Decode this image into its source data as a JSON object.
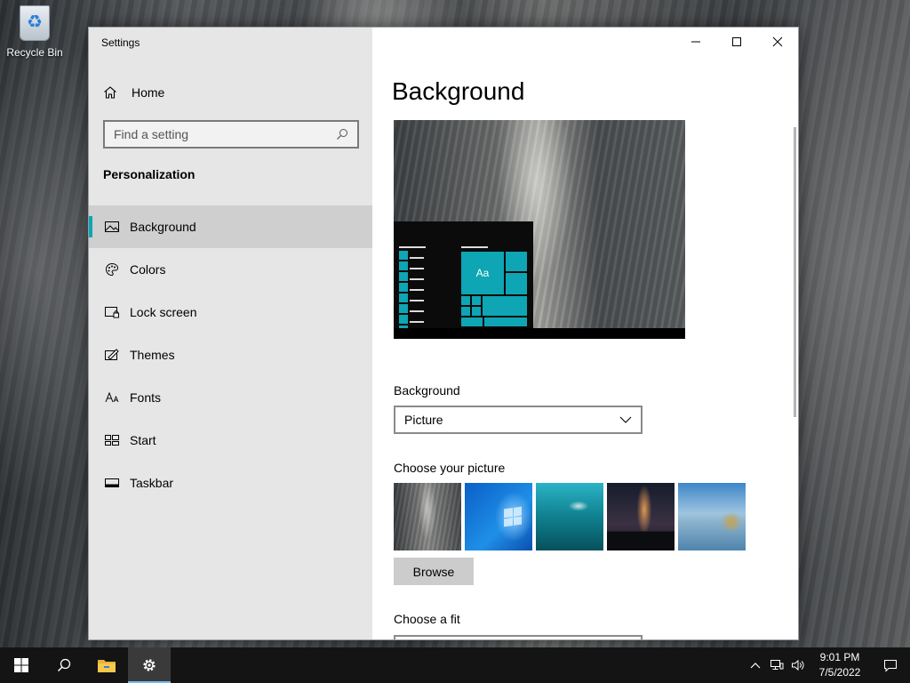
{
  "desktop": {
    "icons": [
      {
        "label": "Recycle Bin",
        "icon": "recycle-bin-icon"
      }
    ]
  },
  "window": {
    "title": "Settings",
    "controls": {
      "minimize": "minimize-icon",
      "maximize": "maximize-icon",
      "close": "close-icon"
    }
  },
  "sidebar": {
    "home_label": "Home",
    "search_placeholder": "Find a setting",
    "section_title": "Personalization",
    "items": [
      {
        "label": "Background",
        "icon": "picture-icon",
        "active": true
      },
      {
        "label": "Colors",
        "icon": "palette-icon",
        "active": false
      },
      {
        "label": "Lock screen",
        "icon": "lock-screen-icon",
        "active": false
      },
      {
        "label": "Themes",
        "icon": "themes-icon",
        "active": false
      },
      {
        "label": "Fonts",
        "icon": "fonts-icon",
        "active": false
      },
      {
        "label": "Start",
        "icon": "start-icon",
        "active": false
      },
      {
        "label": "Taskbar",
        "icon": "taskbar-icon",
        "active": false
      }
    ]
  },
  "main": {
    "page_title": "Background",
    "preview": {
      "tile_text": "Aa"
    },
    "background_label": "Background",
    "background_value": "Picture",
    "choose_picture_label": "Choose your picture",
    "browse_label": "Browse",
    "choose_fit_label": "Choose a fit"
  },
  "taskbar": {
    "start": "windows-start-icon",
    "search": "search-icon",
    "apps": [
      "file-explorer-icon",
      "settings-gear-icon"
    ],
    "tray": [
      "chevron-up-icon",
      "network-icon",
      "volume-icon"
    ],
    "time": "9:01 PM",
    "date": "7/5/2022",
    "notification": "action-center-icon"
  },
  "colors": {
    "accent": "#0ea5b4",
    "taskbar": "#141414",
    "sidebar": "#e6e6e6"
  }
}
